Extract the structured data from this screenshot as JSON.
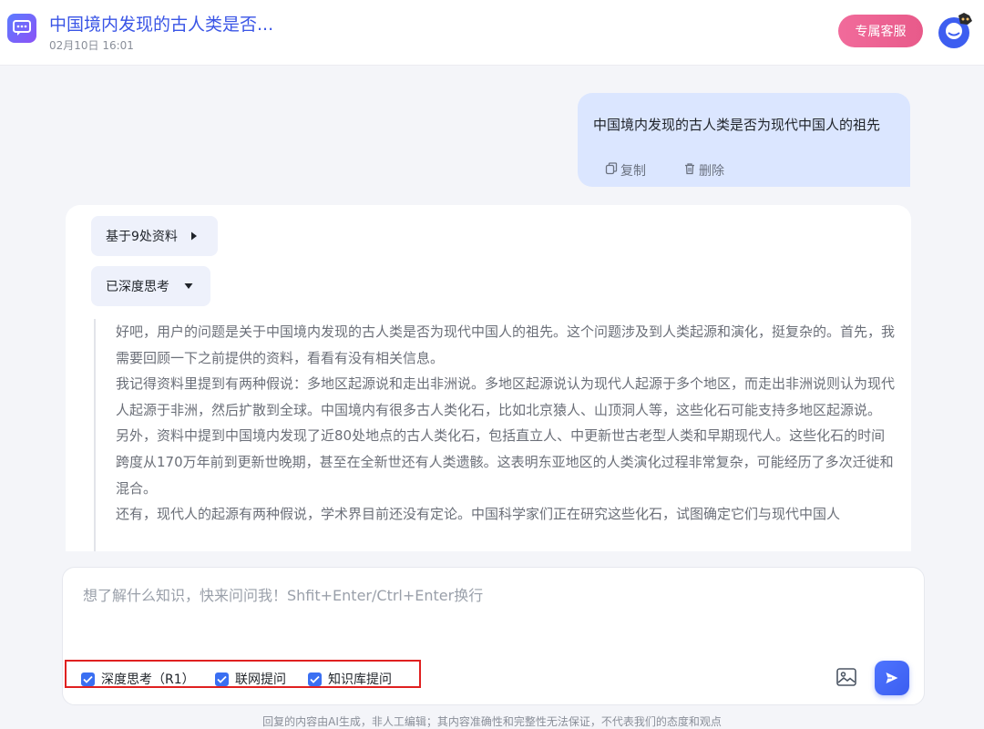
{
  "header": {
    "title": "中国境内发现的古人类是否...",
    "timestamp": "02月10日 16:01",
    "service_button": "专属客服"
  },
  "user_message": {
    "text": "中国境内发现的古人类是否为现代中国人的祖先",
    "copy_label": "复制",
    "delete_label": "删除"
  },
  "answer": {
    "sources_label": "基于9处资料",
    "thinking_label": "已深度思考",
    "thinking_paragraphs": [
      "好吧，用户的问题是关于中国境内发现的古人类是否为现代中国人的祖先。这个问题涉及到人类起源和演化，挺复杂的。首先，我需要回顾一下之前提供的资料，看看有没有相关信息。",
      "我记得资料里提到有两种假说：多地区起源说和走出非洲说。多地区起源说认为现代人起源于多个地区，而走出非洲说则认为现代人起源于非洲，然后扩散到全球。中国境内有很多古人类化石，比如北京猿人、山顶洞人等，这些化石可能支持多地区起源说。",
      "另外，资料中提到中国境内发现了近80处地点的古人类化石，包括直立人、中更新世古老型人类和早期现代人。这些化石的时间跨度从170万年前到更新世晚期，甚至在全新世还有人类遗骸。这表明东亚地区的人类演化过程非常复杂，可能经历了多次迁徙和混合。",
      "还有，现代人的起源有两种假说，学术界目前还没有定论。中国科学家们正在研究这些化石，试图确定它们与现代中国人"
    ]
  },
  "composer": {
    "placeholder": "想了解什么知识，快来问问我！Shfit+Enter/Ctrl+Enter换行",
    "options": [
      {
        "label": "深度思考（R1）",
        "checked": true
      },
      {
        "label": "联网提问",
        "checked": true
      },
      {
        "label": "知识库提问",
        "checked": true
      }
    ]
  },
  "footer": {
    "disclaimer": "回复的内容由AI生成，非人工编辑；其内容准确性和完整性无法保证，不代表我们的态度和观点"
  },
  "colors": {
    "accent": "#3a6ff2",
    "title": "#3a55e6",
    "service_button": "#ec6594",
    "user_bubble": "#dbe6ff",
    "highlight_frame": "#e02020"
  },
  "icons": [
    "chat-app-icon",
    "avatar-icon",
    "copy-icon",
    "trash-icon",
    "caret-right-icon",
    "caret-down-icon",
    "checkbox-icon",
    "image-icon",
    "send-icon"
  ]
}
